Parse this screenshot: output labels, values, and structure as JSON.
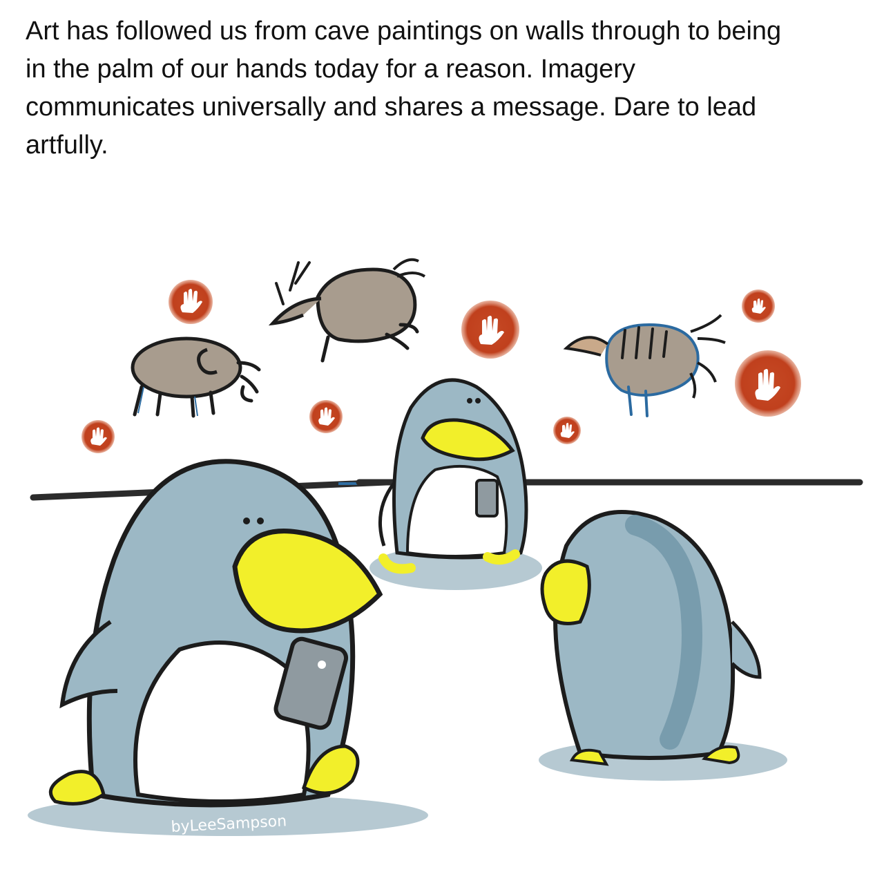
{
  "caption": {
    "text": "Art has followed us from cave paintings on walls through to being in the palm of our hands today for a reason. Imagery communicates universally and shares a message. Dare to lead artfully."
  },
  "illustration": {
    "signature": "byLeeSampson",
    "subjects": [
      "penguin-icon",
      "cave-painting-icon",
      "handprint-icon",
      "smartphone-icon"
    ],
    "colors": {
      "penguin_body": "#9cb8c5",
      "penguin_dark": "#6f95a6",
      "beak": "#f2ef2a",
      "handprint": "#c4401f",
      "animal_fill": "#a89c8e",
      "outline": "#1c1c1c",
      "ground_shadow": "#b6c9d2"
    }
  }
}
